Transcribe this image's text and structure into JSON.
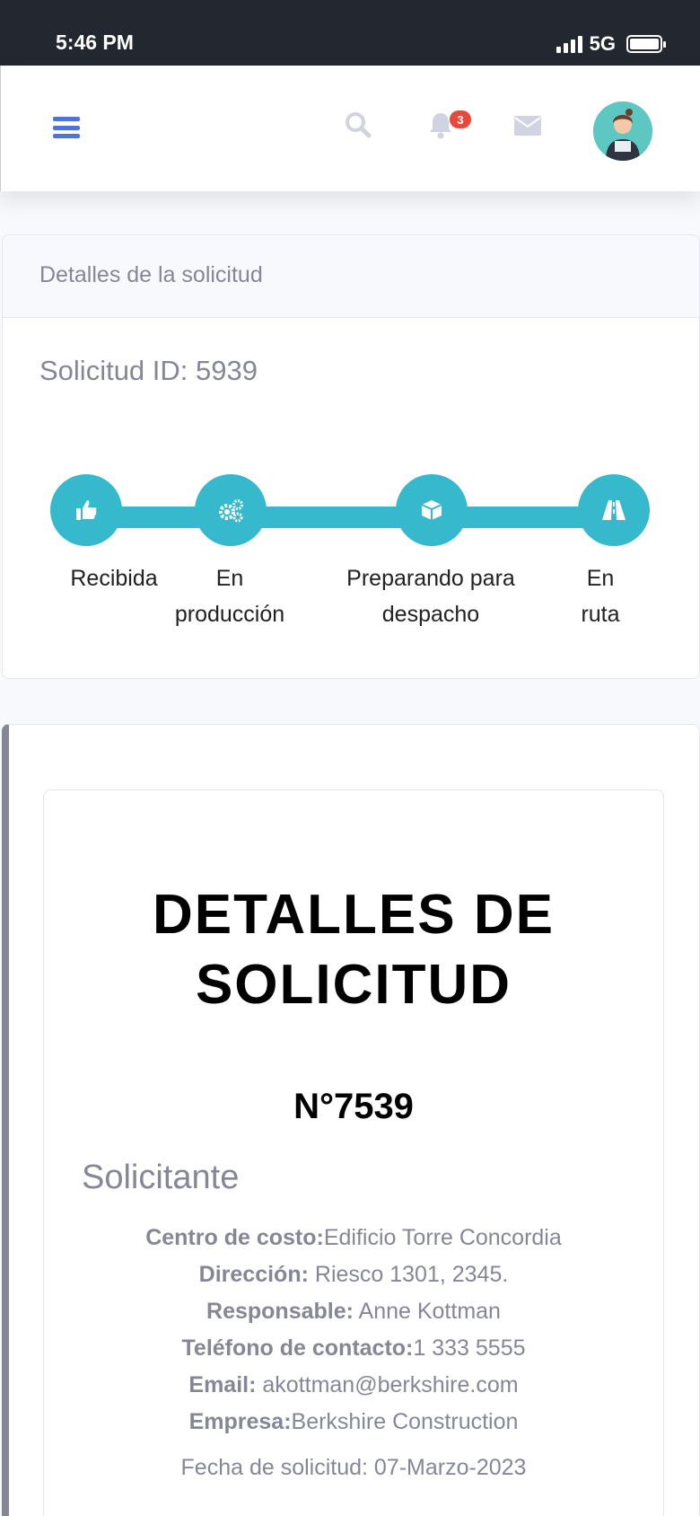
{
  "status_bar": {
    "time": "5:46 PM",
    "network": "5G"
  },
  "topbar": {
    "notification_count": "3"
  },
  "request_card": {
    "header": "Detalles de la solicitud",
    "request_id": "Solicitud ID: 5939",
    "steps": [
      {
        "label": "Recibida",
        "icon": "thumbs-up-icon"
      },
      {
        "label": "En producción",
        "icon": "cogs-icon"
      },
      {
        "label": "Preparando para despacho",
        "icon": "box-icon"
      },
      {
        "label": "En ruta",
        "icon": "road-icon"
      }
    ],
    "accent": "#36b9cc"
  },
  "details": {
    "title": "DETALLES DE SOLICITUD",
    "number": "N°7539",
    "section": "Solicitante",
    "fields": [
      {
        "label": "Centro de costo:",
        "value": "Edificio Torre Concordia"
      },
      {
        "label": "Dirección:",
        "value": " Riesco 1301, 2345."
      },
      {
        "label": "Responsable:",
        "value": " Anne Kottman"
      },
      {
        "label": "Teléfono de contacto:",
        "value": "1 333 5555"
      },
      {
        "label": "Email:",
        "value": " akottman@berkshire.com"
      },
      {
        "label": "Empresa:",
        "value": "Berkshire Construction"
      }
    ],
    "date": "Fecha de solicitud: 07-Marzo-2023"
  }
}
